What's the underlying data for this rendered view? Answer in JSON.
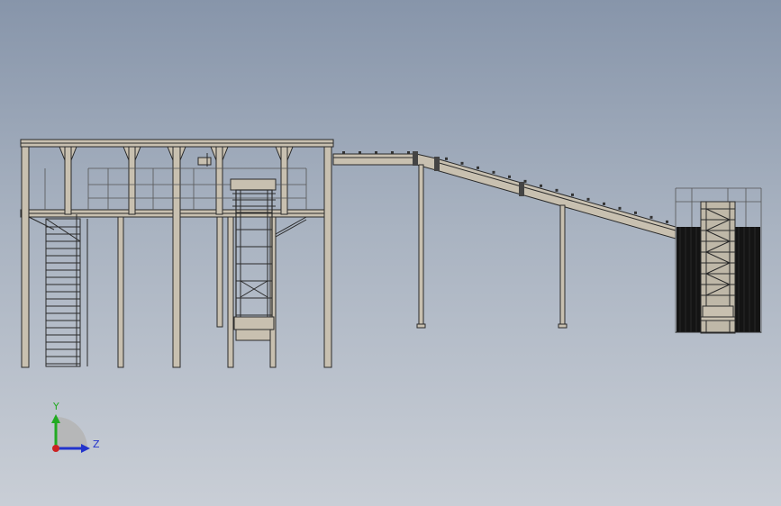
{
  "triad": {
    "y_label": "Y",
    "z_label": "Z",
    "y_color": "#22aa22",
    "z_color": "#2233cc",
    "x_color": "#cc2222"
  },
  "colors": {
    "background_top": "#8795aa",
    "background_bottom": "#c9ced6",
    "steel": "#c8c0b0",
    "edge": "#2a2a2a"
  }
}
